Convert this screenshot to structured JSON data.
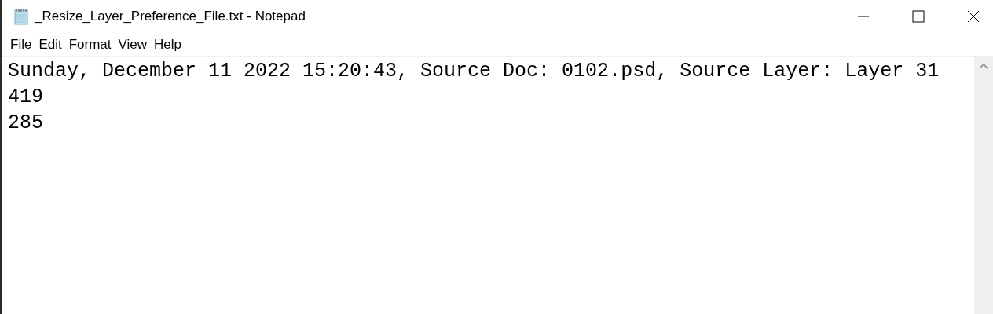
{
  "window": {
    "title": "_Resize_Layer_Preference_File.txt - Notepad"
  },
  "menu": [
    "File",
    "Edit",
    "Format",
    "View",
    "Help"
  ],
  "document": {
    "lines": [
      "Sunday, December 11 2022 15:20:43, Source Doc: 0102.psd, Source Layer: Layer 31",
      "419",
      "285"
    ]
  }
}
